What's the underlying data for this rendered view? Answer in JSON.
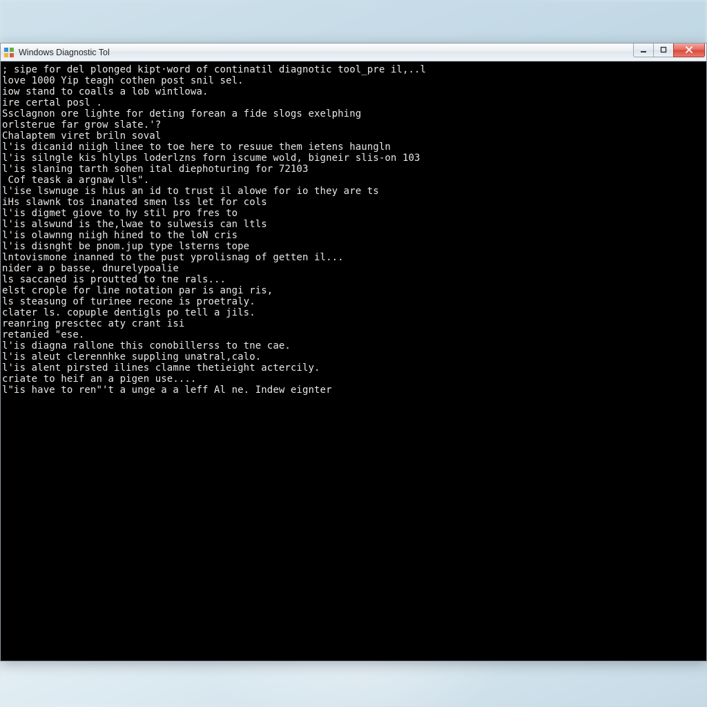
{
  "window": {
    "title": "Windows Diagnostic Tol"
  },
  "console": {
    "lines": [
      "; sipe for del plonged kipt·word of continatil diagnotic tool_pre il,..l",
      "",
      "love 1000 Yip teagh cothen post snil sel.",
      "iow stand to coalls a lob wintlowa.",
      "",
      "ire certal posl .",
      "Ssclagnon ore lighte for deting forean a fide slogs exelphing",
      "orlsterue far grow slate.'?",
      "",
      "Chalaptem viret briln soval",
      "l'is dicanid niigh linee to toe here to resuue them ietens haungln",
      "l'is silngle kis hlylps loderlzns forn iscume wold, bigneir slis-on 103",
      "l'is slaning tarth sohen ital diephoturing for 72103",
      "",
      " Cof teask a argnaw lls\".",
      "l'ise lswnuge is hius an id to trust il alowe for io they are ts",
      "iHs slawnk tos inanated smen lss let for cols",
      "l'is digmet giove to hy stil pro fres to",
      "l'is alswund is the,lwae to sulwesis can ltls",
      "l'is olawnng niigh hined to the loN cris",
      "l'is disnght be pnom.jup type lsterns tope",
      "lntovismone inanned to the pust yprolisnag of getten il...",
      "nider a p basse, dnurelypoalie",
      "ls saccaned is proutted to tne rals...",
      "elst crople for line notation par is angi ris,",
      "ls steasung of turinee recone is proetraly.",
      "clater ls. copuple dentigls po tell a jils.",
      "reanring presctec aty crant isi",
      "retanied \"ese.",
      "l'is diagna rallone this conobillerss to tne cae.",
      "l'is aleut clerennhke suppling unatral,calo.",
      "l'is alent pirsted ilines clamne thetieight actercily.",
      "criate to heif an a pigen use....",
      "",
      "l\"is have to ren\"'t a unge a a leff Al ne. Indew eignter"
    ]
  }
}
